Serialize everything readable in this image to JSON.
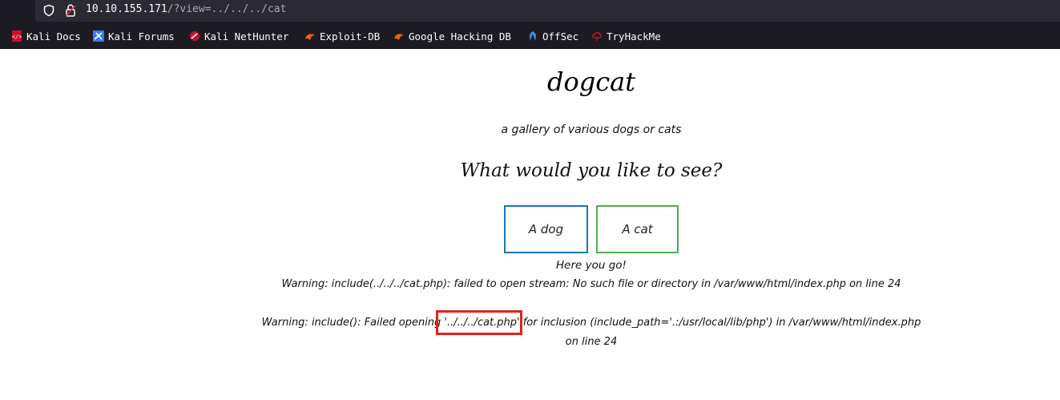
{
  "browser": {
    "url_host": "10.10.155.171",
    "url_path": "/?view=../../../cat",
    "bookmarks": [
      {
        "label": "Kali Docs",
        "icon": "kali-docs-icon"
      },
      {
        "label": "Kali Forums",
        "icon": "kali-forums-icon"
      },
      {
        "label": "Kali NetHunter",
        "icon": "kali-nethunter-icon"
      },
      {
        "label": "Exploit-DB",
        "icon": "exploit-db-icon"
      },
      {
        "label": "Google Hacking DB",
        "icon": "ghdb-icon"
      },
      {
        "label": "OffSec",
        "icon": "offsec-icon"
      },
      {
        "label": "TryHackMe",
        "icon": "tryhackme-icon"
      }
    ]
  },
  "page": {
    "title": "dogcat",
    "subtitle": "a gallery of various dogs or cats",
    "question": "What would you like to see?",
    "dog_button": "A dog",
    "cat_button": "A cat",
    "result": "Here you go!",
    "warning1": "Warning: include(../../../cat.php): failed to open stream: No such file or directory in /var/www/html/index.php on line 24",
    "warning2": "Warning: include(): Failed opening '../../../cat.php' for inclusion (include_path='.:/usr/local/lib/php') in /var/www/html/index.php",
    "warning3": "on line 24"
  },
  "colors": {
    "dog_button_border": "#1a78b4",
    "cat_button_border": "#4fae4f",
    "highlight_box": "#e0211b"
  }
}
